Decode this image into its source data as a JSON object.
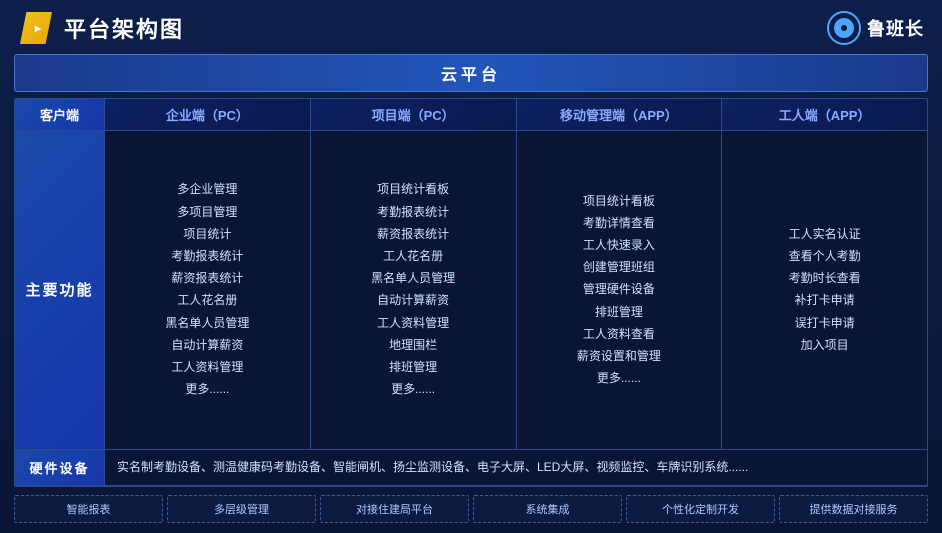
{
  "header": {
    "title": "平台架构图",
    "brand_name": "鲁班长"
  },
  "cloud_banner": "云平台",
  "columns": {
    "client": "客户端",
    "enterprise": "企业端（PC）",
    "project": "项目端（PC）",
    "mobile": "移动管理端（APP）",
    "worker": "工人端（APP）"
  },
  "row_label": "主要功能",
  "enterprise_features": [
    "多企业管理",
    "多项目管理",
    "项目统计",
    "考勤报表统计",
    "薪资报表统计",
    "工人花名册",
    "黑名单人员管理",
    "自动计算薪资",
    "工人资料管理",
    "更多......"
  ],
  "project_features": [
    "项目统计看板",
    "考勤报表统计",
    "薪资报表统计",
    "工人花名册",
    "黑名单人员管理",
    "自动计算薪资",
    "工人资料管理",
    "地理围栏",
    "排班管理",
    "更多......"
  ],
  "mobile_features": [
    "项目统计看板",
    "考勤详情查看",
    "工人快速录入",
    "创建管理班组",
    "管理硬件设备",
    "排班管理",
    "工人资料查看",
    "薪资设置和管理",
    "更多......"
  ],
  "worker_features": [
    "工人实名认证",
    "查看个人考勤",
    "考勤时长查看",
    "补打卡申请",
    "误打卡申请",
    "加入项目"
  ],
  "hardware": {
    "label": "硬件设备",
    "content": "实名制考勤设备、测温健康码考勤设备、智能闸机、扬尘监测设备、电子大屏、LED大屏、视频监控、车牌识别系统......"
  },
  "features": [
    "智能报表",
    "多层级管理",
    "对接住建局平台",
    "系统集成",
    "个性化定制开发",
    "提供数据对接服务"
  ]
}
